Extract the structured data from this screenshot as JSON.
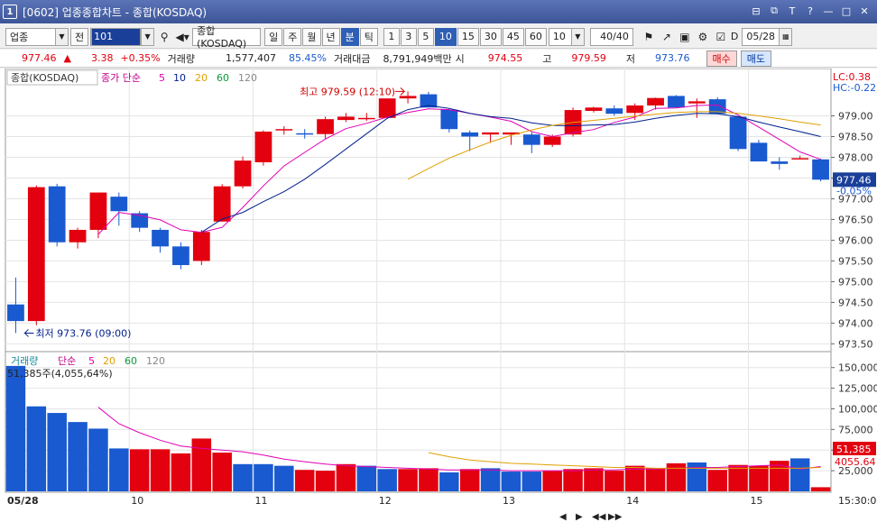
{
  "window": {
    "number": "1",
    "title": "[0602] 업종종합차트 - 종합(KOSDAQ)"
  },
  "toolbar": {
    "market": "업종",
    "all_btn": "전",
    "code": "101",
    "name_field": "종합(KOSDAQ)",
    "periods": [
      "일",
      "주",
      "월",
      "년",
      "분",
      "틱"
    ],
    "selected_period": "분",
    "intervals": [
      "1",
      "3",
      "5",
      "10",
      "15",
      "30",
      "45",
      "60"
    ],
    "selected_interval": "10",
    "interval_combo": "10",
    "count_field": "40",
    "count_suffix": "/40",
    "date_check": "D",
    "date_field": "05/28"
  },
  "quote": {
    "price": "977.46",
    "change_arrow": "▲",
    "change": "3.38",
    "change_pct": "+0.35%",
    "volume_label": "거래량",
    "volume": "1,577,407",
    "volume_ratio": "85.45%",
    "amount_label": "거래대금",
    "amount": "8,791,949백만",
    "open_label": "시",
    "open": "974.55",
    "high_label": "고",
    "high": "979.59",
    "low_label": "저",
    "low": "973.76",
    "buy_btn": "매수",
    "sell_btn": "매도"
  },
  "price_panel": {
    "legend_name": "종합(KOSDAQ)",
    "ma_label": "종가 단순",
    "ma_periods": [
      "5",
      "10",
      "20",
      "60",
      "120"
    ],
    "ma_colors": [
      "#e100b4",
      "#001f8c",
      "#e0a000",
      "#0a9a3a",
      "#888888"
    ],
    "high_note": "최고 979.59 (12:10)",
    "low_note": "최저 973.76 (09:00)",
    "lc": "LC:0.38",
    "hc": "HC:-0.22",
    "current_tag": "977.46",
    "current_pct": "-0.05%",
    "y_ticks": [
      "979.00",
      "978.50",
      "978.00",
      "977.50",
      "977.00",
      "976.50",
      "976.00",
      "975.50",
      "975.00",
      "974.50",
      "974.00",
      "973.50"
    ]
  },
  "volume_panel": {
    "legend": "거래량",
    "ma_label": "단순",
    "ma_periods": [
      "5",
      "20",
      "60",
      "120"
    ],
    "info": "51,385주(4,055,64%)",
    "y_ticks": [
      "150,000",
      "125,000",
      "100,000",
      "75,000",
      "50,000",
      "25,000"
    ],
    "tag_volume": "51,385",
    "tag_ma": "4055.64"
  },
  "x_axis": {
    "labels": [
      "05/28",
      "10",
      "11",
      "12",
      "13",
      "14",
      "15"
    ],
    "time_right": "15:30:00"
  },
  "colors": {
    "up": "#e3000f",
    "down": "#1a5ad0",
    "grid": "#e4e4e4"
  },
  "chart_data": {
    "type": "candlestick",
    "x": [
      "09:00",
      "09:10",
      "09:20",
      "09:30",
      "09:40",
      "09:50",
      "10:00",
      "10:10",
      "10:20",
      "10:30",
      "10:40",
      "10:50",
      "11:00",
      "11:10",
      "11:20",
      "11:30",
      "11:40",
      "11:50",
      "12:00",
      "12:10",
      "12:20",
      "12:30",
      "12:40",
      "12:50",
      "13:00",
      "13:10",
      "13:20",
      "13:30",
      "13:40",
      "13:50",
      "14:00",
      "14:10",
      "14:20",
      "14:30",
      "14:40",
      "14:50",
      "15:00",
      "15:10",
      "15:20",
      "15:30"
    ],
    "ohlc": [
      [
        974.45,
        975.1,
        973.76,
        974.05
      ],
      [
        974.05,
        977.32,
        973.95,
        977.28
      ],
      [
        977.3,
        977.36,
        975.85,
        975.95
      ],
      [
        975.95,
        976.3,
        975.8,
        976.25
      ],
      [
        976.25,
        977.15,
        976.05,
        977.15
      ],
      [
        977.05,
        977.15,
        976.35,
        976.7
      ],
      [
        976.65,
        976.7,
        976.2,
        976.3
      ],
      [
        976.25,
        976.3,
        975.7,
        975.85
      ],
      [
        975.85,
        975.95,
        975.3,
        975.4
      ],
      [
        975.5,
        976.25,
        975.4,
        976.2
      ],
      [
        976.45,
        977.35,
        976.45,
        977.3
      ],
      [
        977.3,
        978.02,
        977.25,
        977.92
      ],
      [
        977.88,
        978.65,
        977.8,
        978.62
      ],
      [
        978.65,
        978.75,
        978.55,
        978.68
      ],
      [
        978.58,
        978.68,
        978.45,
        978.55
      ],
      [
        978.56,
        978.98,
        978.45,
        978.92
      ],
      [
        978.9,
        979.07,
        978.85,
        978.98
      ],
      [
        978.92,
        979.07,
        978.88,
        978.95
      ],
      [
        978.95,
        979.42,
        978.93,
        979.42
      ],
      [
        979.42,
        979.59,
        979.3,
        979.48
      ],
      [
        979.52,
        979.58,
        979.2,
        979.2
      ],
      [
        979.15,
        979.17,
        978.6,
        978.68
      ],
      [
        978.6,
        978.65,
        978.15,
        978.5
      ],
      [
        978.55,
        978.6,
        978.35,
        978.6
      ],
      [
        978.55,
        978.6,
        978.3,
        978.6
      ],
      [
        978.55,
        978.6,
        978.1,
        978.3
      ],
      [
        978.3,
        978.55,
        978.25,
        978.5
      ],
      [
        978.55,
        979.2,
        978.5,
        979.14
      ],
      [
        979.12,
        979.22,
        979.08,
        979.2
      ],
      [
        979.18,
        979.25,
        979.0,
        979.05
      ],
      [
        979.07,
        979.3,
        978.9,
        979.25
      ],
      [
        979.25,
        979.44,
        979.15,
        979.43
      ],
      [
        979.48,
        979.5,
        979.3,
        979.2
      ],
      [
        979.3,
        979.42,
        978.95,
        979.35
      ],
      [
        979.4,
        979.45,
        979.1,
        979.05
      ],
      [
        978.98,
        979.0,
        978.15,
        978.2
      ],
      [
        978.35,
        978.42,
        977.9,
        977.9
      ],
      [
        977.9,
        978.0,
        977.7,
        977.84
      ],
      [
        977.98,
        978.04,
        977.95,
        977.98
      ],
      [
        977.95,
        977.97,
        977.42,
        977.46
      ]
    ],
    "ma5": [
      null,
      null,
      null,
      null,
      976.14,
      976.67,
      976.6,
      976.49,
      976.25,
      976.19,
      976.31,
      976.79,
      977.31,
      977.79,
      978.12,
      978.44,
      978.69,
      978.82,
      978.97,
      979.08,
      979.17,
      979.15,
      979.06,
      978.97,
      978.87,
      978.62,
      978.5,
      978.59,
      978.67,
      978.84,
      978.97,
      979.18,
      979.19,
      979.25,
      979.26,
      979.02,
      978.73,
      978.43,
      978.13,
      977.95
    ],
    "ma10": [
      null,
      null,
      null,
      null,
      null,
      null,
      null,
      null,
      null,
      976.19,
      976.51,
      976.67,
      976.93,
      977.17,
      977.47,
      977.83,
      978.2,
      978.57,
      978.94,
      979.15,
      979.25,
      979.18,
      979.06,
      978.98,
      978.94,
      978.83,
      978.77,
      978.76,
      978.78,
      978.79,
      978.85,
      978.94,
      979.01,
      979.06,
      979.05,
      978.98,
      978.85,
      978.73,
      978.62,
      978.5
    ],
    "ma20": [
      null,
      null,
      null,
      null,
      null,
      null,
      null,
      null,
      null,
      null,
      null,
      null,
      null,
      null,
      null,
      null,
      null,
      null,
      null,
      977.47,
      977.73,
      977.98,
      978.18,
      978.37,
      978.53,
      978.66,
      978.77,
      978.84,
      978.89,
      978.94,
      978.99,
      979.04,
      979.08,
      979.1,
      979.1,
      979.06,
      979.0,
      978.93,
      978.85,
      978.78
    ],
    "volume": [
      152000,
      103000,
      95000,
      84000,
      76000,
      52000,
      51000,
      51000,
      46000,
      64000,
      47000,
      33000,
      33000,
      31000,
      26000,
      25000,
      33000,
      31000,
      27000,
      27000,
      28000,
      23000,
      27000,
      28000,
      24000,
      24000,
      25000,
      27000,
      28000,
      25000,
      31000,
      28000,
      34000,
      35000,
      26000,
      32000,
      31000,
      37000,
      40000,
      5000,
      51385
    ],
    "vol_up": [
      false,
      false,
      false,
      false,
      false,
      false,
      true,
      true,
      true,
      true,
      true,
      false,
      false,
      false,
      true,
      true,
      true,
      false,
      false,
      true,
      true,
      false,
      true,
      false,
      false,
      false,
      true,
      true,
      true,
      true,
      true,
      true,
      true,
      false,
      true,
      true,
      true,
      true,
      false,
      true
    ],
    "vol_ma5": [
      null,
      null,
      null,
      null,
      102000,
      82000,
      71000,
      62000,
      55000,
      52000,
      50000,
      48000,
      44000,
      39000,
      36000,
      33000,
      31000,
      30000,
      29000,
      28000,
      27000,
      26000,
      26000,
      26000,
      25000,
      25000,
      25000,
      25000,
      26000,
      26000,
      27000,
      27000,
      28000,
      29000,
      29000,
      30000,
      31000,
      32000,
      27000,
      30000
    ],
    "vol_ma20": [
      null,
      null,
      null,
      null,
      null,
      null,
      null,
      null,
      null,
      null,
      null,
      null,
      null,
      null,
      null,
      null,
      null,
      null,
      null,
      null,
      47000,
      42000,
      38000,
      36000,
      34000,
      33000,
      32000,
      31000,
      30000,
      29000,
      29000,
      28000,
      28000,
      28000,
      28000,
      28000,
      28000,
      28000,
      28000,
      29000
    ],
    "price_ylim": [
      973.4,
      979.75
    ],
    "volume_ylim": [
      0,
      165000
    ]
  }
}
